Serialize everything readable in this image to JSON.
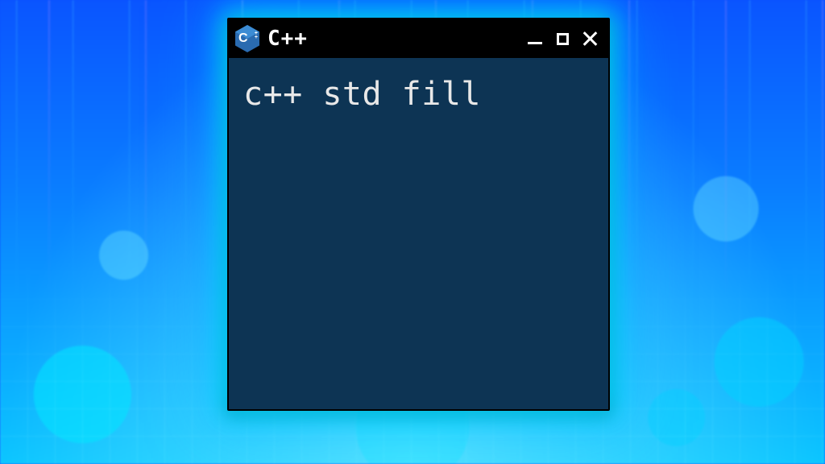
{
  "window": {
    "title": "C++",
    "icon_name": "cpp-hex-icon",
    "content": "c++ std fill"
  },
  "controls": {
    "minimize": "minimize",
    "maximize": "maximize",
    "close": "close"
  }
}
